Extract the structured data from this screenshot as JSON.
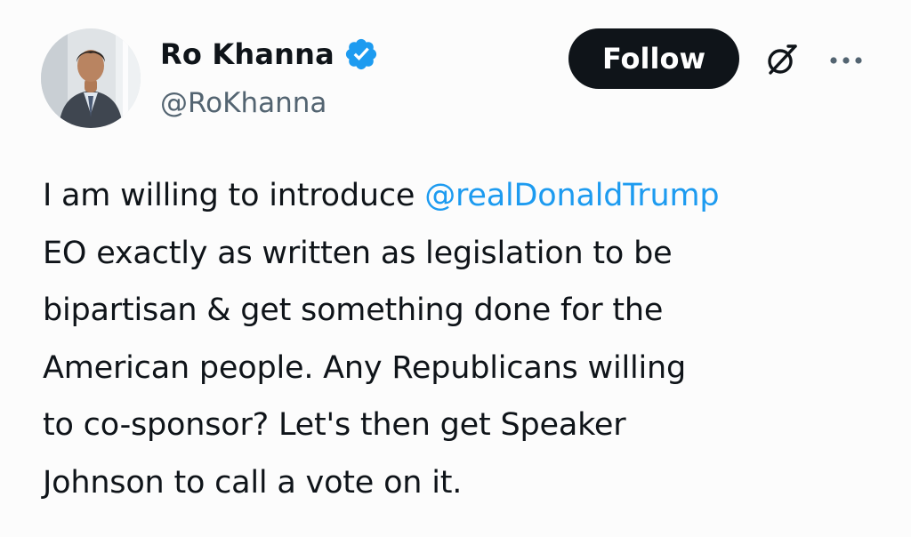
{
  "author": {
    "display_name": "Ro Khanna",
    "handle": "@RoKhanna",
    "verified": true,
    "avatar_alt": "Profile photo of Ro Khanna"
  },
  "actions": {
    "follow_label": "Follow",
    "grok_icon": "grok-icon",
    "more_icon": "more-icon"
  },
  "tweet": {
    "line_1_prefix": "I am willing to introduce ",
    "mention": "@realDonaldTrump",
    "line_2": "EO exactly as written as legislation to be",
    "line_3": "bipartisan & get something done for the",
    "line_4": "American people. Any Republicans willing",
    "line_5": "to co-sponsor? Let's then get Speaker",
    "line_6": "Johnson to call a vote on it."
  },
  "colors": {
    "background": "#fcfcfc",
    "text": "#0f1419",
    "secondary_text": "#536471",
    "link": "#1d9bf0",
    "verified_badge": "#1d9bf0",
    "follow_button_bg": "#0f1419",
    "follow_button_text": "#ffffff"
  }
}
